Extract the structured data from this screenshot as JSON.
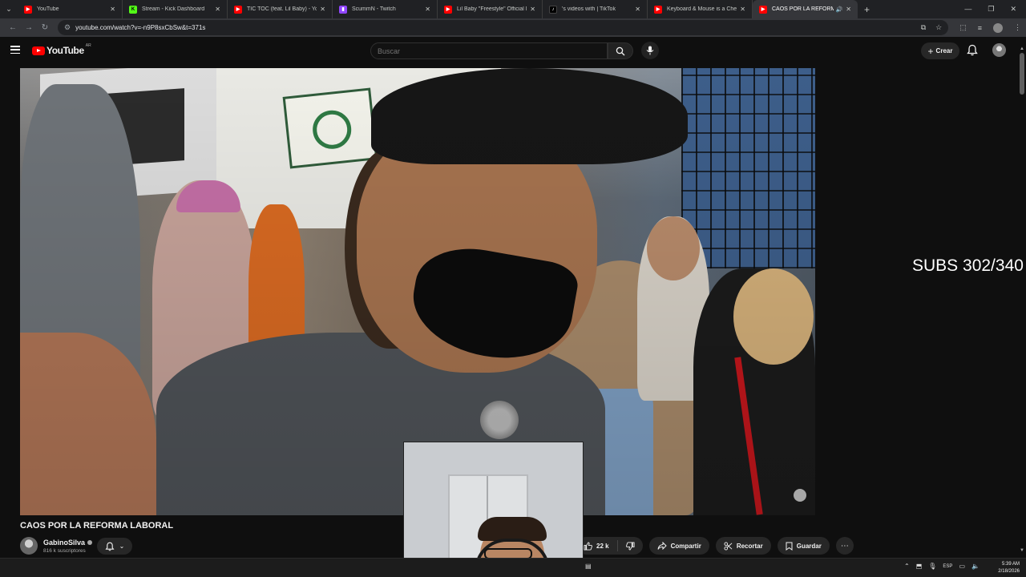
{
  "browser": {
    "tabs": [
      {
        "title": "YouTube",
        "icon": "youtube-icon",
        "active": false
      },
      {
        "title": "Stream - Kick Dashboard",
        "icon": "kick-icon",
        "active": false
      },
      {
        "title": "TIC TOC (feat. Lil Baby) - YouTu",
        "icon": "youtube-icon",
        "active": false
      },
      {
        "title": "ScummN - Twitch",
        "icon": "twitch-icon",
        "active": false
      },
      {
        "title": "Lil Baby \"Freestyle\" Official Mu",
        "icon": "youtube-icon",
        "active": false
      },
      {
        "title": "'s videos with | TikTok",
        "icon": "tiktok-icon",
        "active": false
      },
      {
        "title": "Keyboard & Mouse is a Cheat",
        "icon": "youtube-icon",
        "active": false
      },
      {
        "title": "CAOS POR LA REFORMA L",
        "icon": "youtube-icon",
        "active": true
      }
    ],
    "url": "youtube.com/watch?v=-n9P8sxCbSw&t=371s"
  },
  "youtube": {
    "logo_text": "YouTube",
    "country_code": "AR",
    "search_placeholder": "Buscar",
    "create_label": "Crear"
  },
  "video": {
    "title": "CAOS POR LA REFORMA LABORAL",
    "channel_name": "GabinoSilva",
    "subscribers": "816 k suscriptores",
    "like_count": "22 k",
    "share_label": "Compartir",
    "clip_label": "Recortar",
    "save_label": "Guardar"
  },
  "overlay": {
    "subs_text": "SUBS 302/340"
  },
  "taskbar": {
    "language": "ESP",
    "time": "5:39 AM",
    "date": "2/18/2026"
  },
  "colors": {
    "youtube_red": "#ff0000",
    "background": "#0f0f0f",
    "pill": "#272727"
  }
}
